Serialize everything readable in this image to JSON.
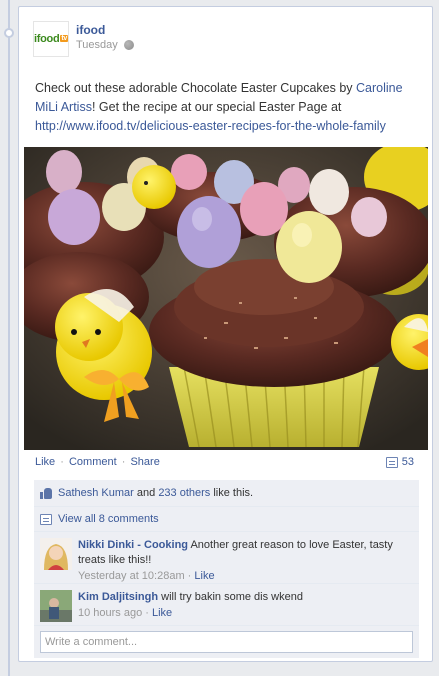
{
  "post": {
    "page_name": "ifood",
    "logo": {
      "text": "ifood",
      "badge": "tv"
    },
    "timestamp": "Tuesday",
    "privacy_icon": "globe-icon",
    "message": {
      "prefix": "Check out these adorable Chocolate Easter Cupcakes by ",
      "mention": "Caroline MiLi Artiss",
      "middle": "! Get the recipe at our special Easter Page at ",
      "link": "http://www.ifood.tv/delicious-easter-recipes-for-the-whole-family"
    },
    "photo_icon": "easter-cupcakes-photo"
  },
  "actions": {
    "like": "Like",
    "comment": "Comment",
    "share": "Share",
    "separator": "·",
    "comment_count": "53",
    "comment_count_icon": "comment-bubble-icon"
  },
  "ufi": {
    "likes": {
      "icon": "thumbs-up-icon",
      "user": "Sathesh Kumar",
      "and": "and",
      "others": "233 others",
      "suffix": "like this."
    },
    "view_all": {
      "icon": "comment-bubble-icon",
      "label": "View all 8 comments"
    },
    "comments": [
      {
        "author": "Nikki Dinki - Cooking",
        "text": "Another great reason to love Easter, tasty treats like this!!",
        "time": "Yesterday at 10:28am",
        "like": "Like"
      },
      {
        "author": "Kim Daljitsingh",
        "text": "will try bakin some dis wkend",
        "time": "10 hours ago",
        "like": "Like"
      }
    ],
    "write_placeholder": "Write a comment..."
  },
  "colors": {
    "link": "#3b5998",
    "muted": "#999999",
    "ufi_bg": "#edeff4"
  }
}
